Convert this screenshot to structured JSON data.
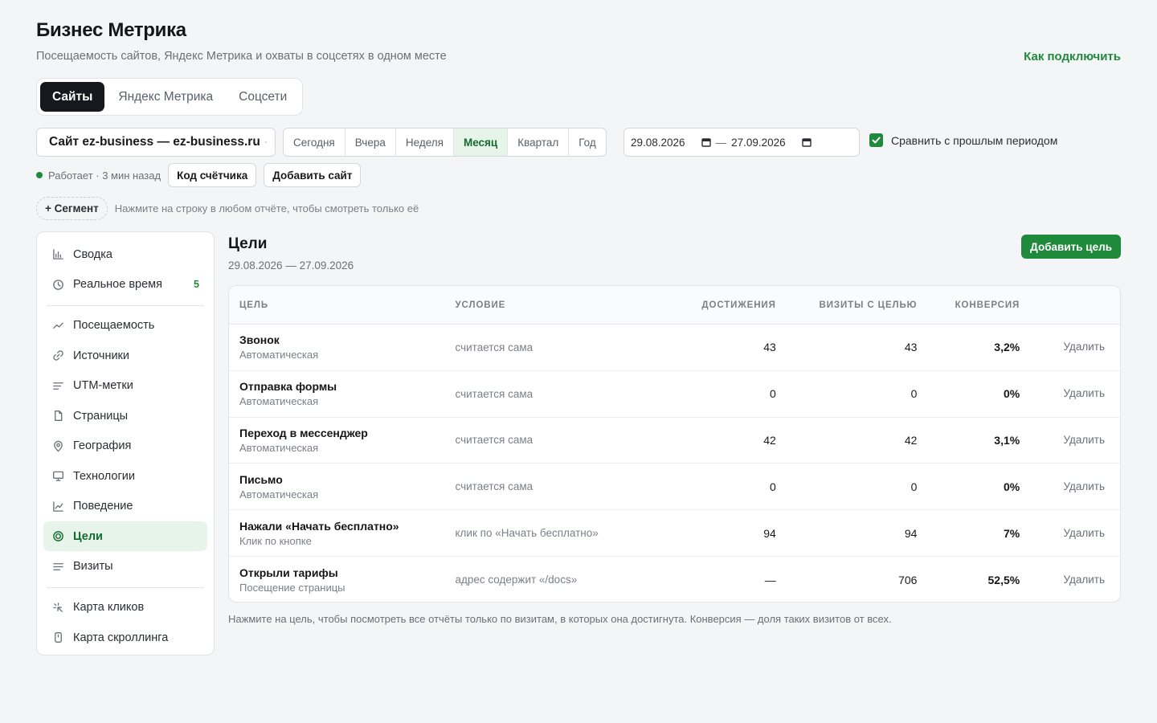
{
  "header": {
    "title": "Бизнес Метрика",
    "subtitle": "Посещаемость сайтов, Яндекс Метрика и охваты в соцсетях в одном месте",
    "connect_link": "Как подключить"
  },
  "tabs": [
    {
      "label": "Сайты",
      "active": true
    },
    {
      "label": "Яндекс Метрика",
      "active": false
    },
    {
      "label": "Соцсети",
      "active": false
    }
  ],
  "toolbar": {
    "site_select": "Сайт ez-business — ez-business.ru",
    "periods": [
      "Сегодня",
      "Вчера",
      "Неделя",
      "Месяц",
      "Квартал",
      "Год"
    ],
    "active_period": "Месяц",
    "date_from": "29.08.2026",
    "date_sep": "—",
    "date_to": "27.09.2026",
    "compare_label": "Сравнить с прошлым периодом",
    "compare_checked": true
  },
  "status": {
    "text": "Работает · 3 мин назад",
    "counter_code_button": "Код счётчика",
    "add_site_button": "Добавить сайт"
  },
  "segment": {
    "button": "+ Сегмент",
    "hint": "Нажмите на строку в любом отчёте, чтобы смотреть только её"
  },
  "sidebar": {
    "groups": [
      [
        {
          "label": "Сводка",
          "icon": "bar-chart-icon"
        },
        {
          "label": "Реальное время",
          "icon": "clock-icon",
          "badge": "5"
        }
      ],
      [
        {
          "label": "Посещаемость",
          "icon": "trend-line-icon"
        },
        {
          "label": "Источники",
          "icon": "link-icon"
        },
        {
          "label": "UTM-метки",
          "icon": "lines-icon"
        },
        {
          "label": "Страницы",
          "icon": "page-icon"
        },
        {
          "label": "География",
          "icon": "map-pin-icon"
        },
        {
          "label": "Технологии",
          "icon": "monitor-icon"
        },
        {
          "label": "Поведение",
          "icon": "line-chart-icon"
        },
        {
          "label": "Цели",
          "icon": "target-icon",
          "active": true
        },
        {
          "label": "Визиты",
          "icon": "list-icon"
        }
      ],
      [
        {
          "label": "Карта кликов",
          "icon": "click-map-icon"
        },
        {
          "label": "Карта скроллинга",
          "icon": "scroll-map-icon"
        }
      ]
    ]
  },
  "goals": {
    "title": "Цели",
    "dates": "29.08.2026 — 27.09.2026",
    "add_button": "Добавить цель",
    "columns": [
      "Цель",
      "Условие",
      "Достижения",
      "Визиты с целью",
      "Конверсия"
    ],
    "delete_label": "Удалить",
    "rows": [
      {
        "name": "Звонок",
        "type": "Автоматическая",
        "condition": "считается сама",
        "achievements": "43",
        "visits": "43",
        "conversion": "3,2%"
      },
      {
        "name": "Отправка формы",
        "type": "Автоматическая",
        "condition": "считается сама",
        "achievements": "0",
        "visits": "0",
        "conversion": "0%"
      },
      {
        "name": "Переход в мессенджер",
        "type": "Автоматическая",
        "condition": "считается сама",
        "achievements": "42",
        "visits": "42",
        "conversion": "3,1%"
      },
      {
        "name": "Письмо",
        "type": "Автоматическая",
        "condition": "считается сама",
        "achievements": "0",
        "visits": "0",
        "conversion": "0%"
      },
      {
        "name": "Нажали «Начать бесплатно»",
        "type": "Клик по кнопке",
        "condition": "клик по «Начать бесплатно»",
        "achievements": "94",
        "visits": "94",
        "conversion": "7%"
      },
      {
        "name": "Открыли тарифы",
        "type": "Посещение страницы",
        "condition": "адрес содержит «/docs»",
        "achievements": "—",
        "visits": "706",
        "conversion": "52,5%"
      }
    ],
    "footnote": "Нажмите на цель, чтобы посмотреть все отчёты только по визитам, в которых она достигнута. Конверсия — доля таких визитов от всех."
  },
  "colors": {
    "accent_green": "#1f8a3b",
    "active_bg": "#e7f4ea",
    "dark_tab": "#15181c"
  }
}
